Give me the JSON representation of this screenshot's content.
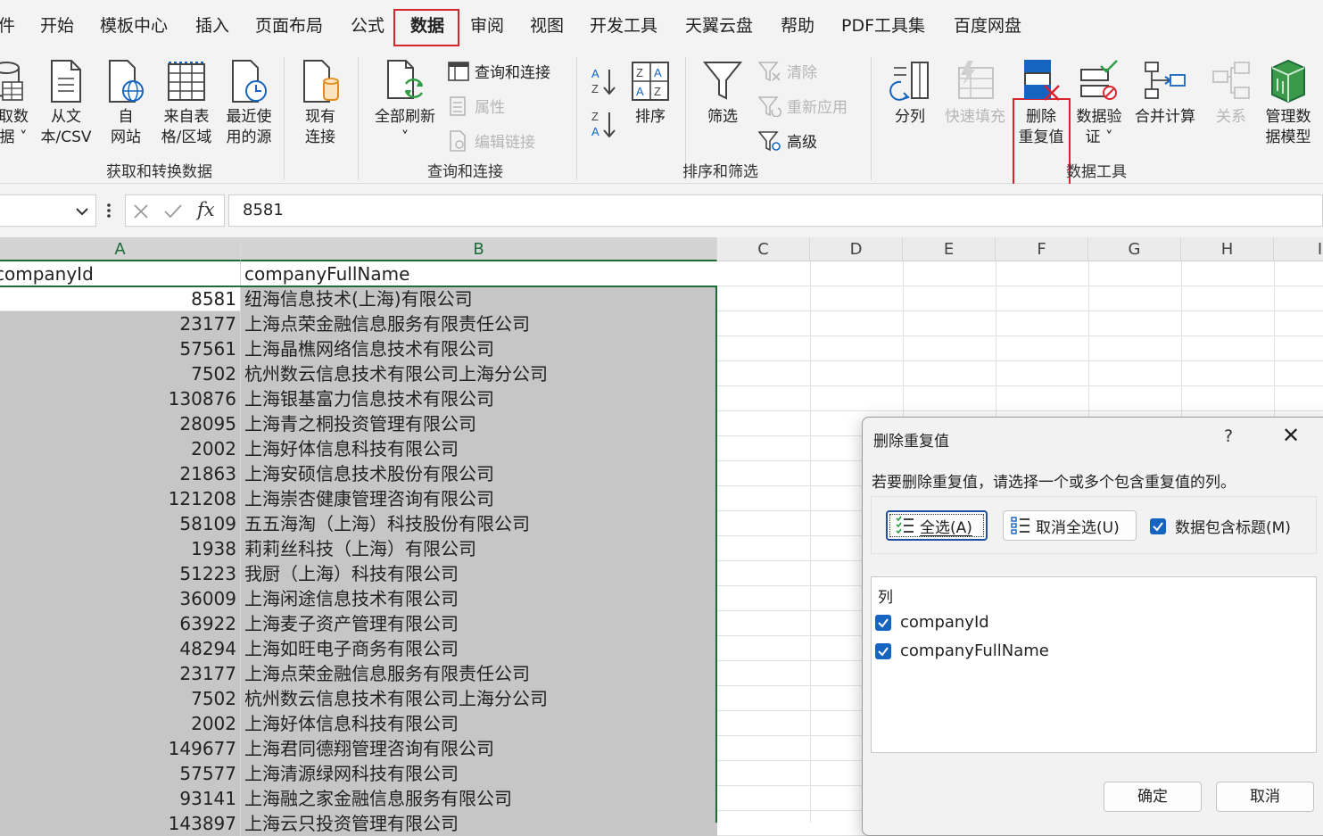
{
  "menu_tabs": [
    "件",
    "开始",
    "模板中心",
    "插入",
    "页面布局",
    "公式",
    "数据",
    "审阅",
    "视图",
    "开发工具",
    "天翼云盘",
    "帮助",
    "PDF工具集",
    "百度网盘"
  ],
  "ribbon": {
    "get_data": {
      "line1": "取数",
      "line2": "据 ˅"
    },
    "from_text": {
      "line1": "从文",
      "line2": "本/CSV"
    },
    "from_web": {
      "line1": "自",
      "line2": "网站"
    },
    "from_table": {
      "line1": "来自表",
      "line2": "格/区域"
    },
    "recent_sources": {
      "line1": "最近使",
      "line2": "用的源"
    },
    "existing_conn": {
      "line1": "现有",
      "line2": "连接"
    },
    "group1_label": "获取和转换数据",
    "refresh_all": {
      "line1": "全部刷新",
      "line2": "˅"
    },
    "queries_connections": "查询和连接",
    "properties": "属性",
    "edit_links": "编辑链接",
    "group2_label": "查询和连接",
    "sort": "排序",
    "filter": "筛选",
    "clear": "清除",
    "reapply": "重新应用",
    "advanced": "高级",
    "group3_label": "排序和筛选",
    "text_to_columns": "分列",
    "flash_fill": "快速填充",
    "remove_duplicates": {
      "line1": "删除",
      "line2": "重复值"
    },
    "data_validation": {
      "line1": "数据验",
      "line2": "证 ˅"
    },
    "consolidate": "合并计算",
    "relationships": "关系",
    "data_model": {
      "line1": "管理数",
      "line2": "据模型"
    },
    "group4_label": "数据工具"
  },
  "formula_bar": {
    "value": "8581",
    "fx": "fx"
  },
  "sheet": {
    "columns": [
      "A",
      "B",
      "C",
      "D",
      "E",
      "F",
      "G",
      "H",
      "I"
    ],
    "header_row": {
      "a": "companyId",
      "b": "companyFullName"
    },
    "rows": [
      {
        "a": "8581",
        "b": "纽海信息技术(上海)有限公司"
      },
      {
        "a": "23177",
        "b": "上海点荣金融信息服务有限责任公司"
      },
      {
        "a": "57561",
        "b": "上海晶樵网络信息技术有限公司"
      },
      {
        "a": "7502",
        "b": "杭州数云信息技术有限公司上海分公司"
      },
      {
        "a": "130876",
        "b": "上海银基富力信息技术有限公司"
      },
      {
        "a": "28095",
        "b": "上海青之桐投资管理有限公司"
      },
      {
        "a": "2002",
        "b": "上海好体信息科技有限公司"
      },
      {
        "a": "21863",
        "b": "上海安硕信息技术股份有限公司"
      },
      {
        "a": "121208",
        "b": "上海崇杏健康管理咨询有限公司"
      },
      {
        "a": "58109",
        "b": "五五海淘（上海）科技股份有限公司"
      },
      {
        "a": "1938",
        "b": "莉莉丝科技（上海）有限公司"
      },
      {
        "a": "51223",
        "b": "我厨（上海）科技有限公司"
      },
      {
        "a": "36009",
        "b": "上海闲途信息技术有限公司"
      },
      {
        "a": "63922",
        "b": "上海麦子资产管理有限公司"
      },
      {
        "a": "48294",
        "b": "上海如旺电子商务有限公司"
      },
      {
        "a": "23177",
        "b": "上海点荣金融信息服务有限责任公司"
      },
      {
        "a": "7502",
        "b": "杭州数云信息技术有限公司上海分公司"
      },
      {
        "a": "2002",
        "b": "上海好体信息科技有限公司"
      },
      {
        "a": "149677",
        "b": "上海君同德翔管理咨询有限公司"
      },
      {
        "a": "57577",
        "b": "上海清源绿网科技有限公司"
      },
      {
        "a": "93141",
        "b": "上海融之家金融信息服务有限公司"
      },
      {
        "a": "143897",
        "b": "上海云只投资管理有限公司"
      }
    ]
  },
  "dialog": {
    "title": "删除重复值",
    "help": "?",
    "close": "✕",
    "message": "若要删除重复值，请选择一个或多个包含重复值的列。",
    "select_all": "全选(A)",
    "unselect_all": "取消全选(U)",
    "has_headers": "数据包含标题(M)",
    "has_headers_checked": true,
    "list_header": "列",
    "columns": [
      {
        "label": "companyId",
        "checked": true
      },
      {
        "label": "companyFullName",
        "checked": true
      }
    ],
    "ok": "确定",
    "cancel": "取消"
  },
  "colors": {
    "accent_red": "#d9232d",
    "excel_green": "#1e6b3a",
    "checkbox_blue": "#1565c0",
    "selection_gray": "#c6c6c6"
  }
}
